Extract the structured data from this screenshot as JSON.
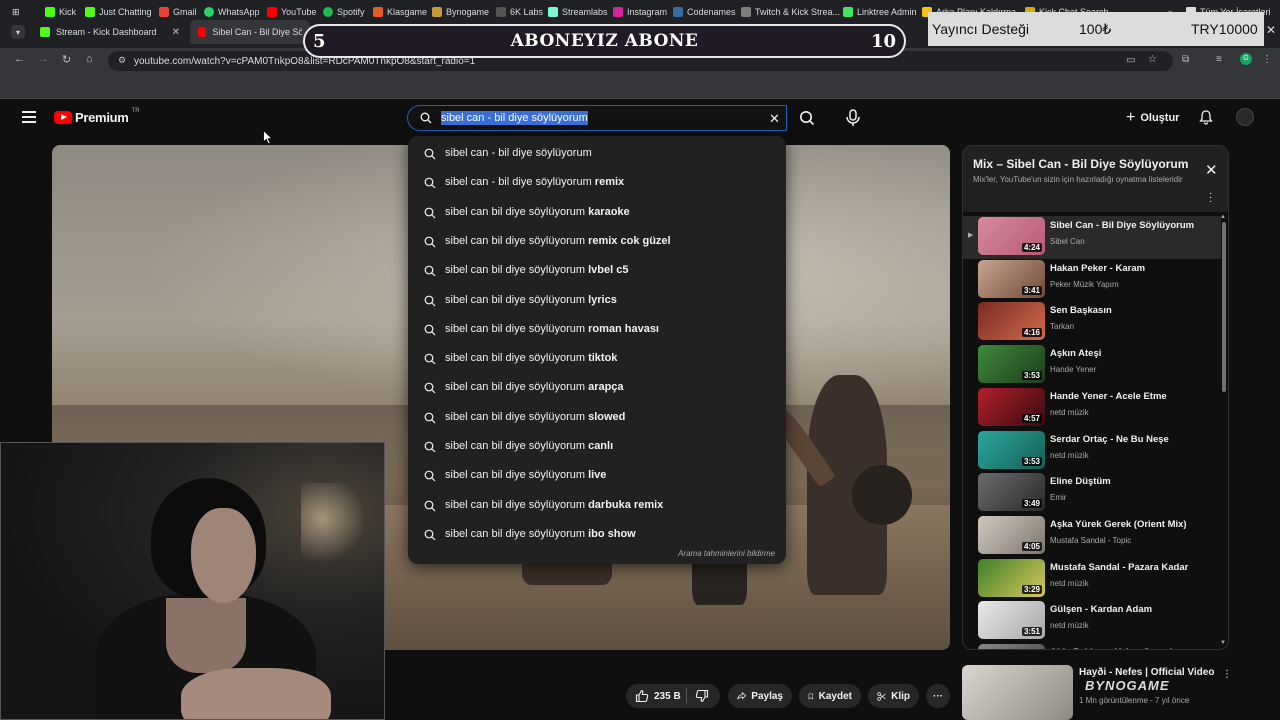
{
  "browser": {
    "tabs": [
      {
        "label": "Stream - Kick Dashboard",
        "fav_color": "#53fc18"
      },
      {
        "label": "Sibel Can - Bil Diye Söylüy",
        "fav_color": "#ff0000"
      }
    ],
    "url": "youtube.com/watch?v=cPAM0TnkpO8&list=RDcPAM0TnkpO8&start_radio=1",
    "bookmarks": [
      "Kick",
      "Just Chatting",
      "Gmail",
      "WhatsApp",
      "YouTube",
      "Spotify",
      "Klasgame",
      "Bynogame",
      "6K Labs",
      "Streamlabs",
      "Instagram",
      "Codenames",
      "Twitch & Kick Strea...",
      "Linktree Admin",
      "Arka Planı Kaldırma...",
      "Kick Chat Search"
    ],
    "all_bookmarks": "Tüm Yer İşaretleri"
  },
  "overlay": {
    "goal_left": "5",
    "goal_title": "ABONEYIZ ABONE",
    "goal_right": "10",
    "donate_label": "Yayıncı Desteği",
    "donate_amount": "100₺",
    "donate_goal": "TRY10000"
  },
  "youtube": {
    "logo": "Premium",
    "country": "TR",
    "search_value": "sibel can - bil diye söylüyorum",
    "create_label": "Oluştur",
    "suggestions": [
      {
        "prefix": "sibel can - bil diye söylüyorum",
        "suffix": ""
      },
      {
        "prefix": "sibel can - bil diye söylüyorum",
        "suffix": " remix"
      },
      {
        "prefix": "sibel can bil diye söylüyorum",
        "suffix": " karaoke"
      },
      {
        "prefix": "sibel can bil diye söylüyorum",
        "suffix": " remix cok güzel"
      },
      {
        "prefix": "sibel can bil diye söylüyorum",
        "suffix": " lvbel c5"
      },
      {
        "prefix": "sibel can bil diye söylüyorum",
        "suffix": " lyrics"
      },
      {
        "prefix": "sibel can bil diye söylüyorum",
        "suffix": " roman havası"
      },
      {
        "prefix": "sibel can bil diye söylüyorum",
        "suffix": " tiktok"
      },
      {
        "prefix": "sibel can bil diye söylüyorum",
        "suffix": " arapça"
      },
      {
        "prefix": "sibel can bil diye söylüyorum",
        "suffix": " slowed"
      },
      {
        "prefix": "sibel can bil diye söylüyorum",
        "suffix": " canlı"
      },
      {
        "prefix": "sibel can bil diye söylüyorum",
        "suffix": " live"
      },
      {
        "prefix": "sibel can bil diye söylüyorum",
        "suffix": " darbuka remix"
      },
      {
        "prefix": "sibel can bil diye söylüyorum",
        "suffix": " ibo show"
      }
    ],
    "suggest_footer": "Arama tahminlerini bildirme",
    "mix": {
      "title": "Mix – Sibel Can - Bil Diye Söylüyorum",
      "subtitle": "Mix'ler, YouTube'un sizin için hazırladığı oynatma listeleridir",
      "items": [
        {
          "title": "Sibel Can - Bil Diye Söylüyorum",
          "channel": "Sibel Can",
          "duration": "4:24",
          "c1": "#d78aa0",
          "c2": "#b85a72"
        },
        {
          "title": "Hakan Peker - Karam",
          "channel": "Peker Müzik Yapım",
          "duration": "3:41",
          "c1": "#c9a48d",
          "c2": "#6e4b3a"
        },
        {
          "title": "Sen Başkasın",
          "channel": "Tarkan",
          "duration": "4:16",
          "c1": "#7a2b22",
          "c2": "#d06b4c"
        },
        {
          "title": "Aşkın Ateşi",
          "channel": "Hande Yener",
          "duration": "3:53",
          "c1": "#3d8a3a",
          "c2": "#1e3d1e"
        },
        {
          "title": "Hande Yener - Acele Etme",
          "channel": "netd müzik",
          "duration": "4:57",
          "c1": "#b0202a",
          "c2": "#3a0a10"
        },
        {
          "title": "Serdar Ortaç - Ne Bu Neşe",
          "channel": "netd müzik",
          "duration": "3:53",
          "c1": "#2aa79b",
          "c2": "#155f58"
        },
        {
          "title": "Eline Düştüm",
          "channel": "Emir",
          "duration": "3:49",
          "c1": "#6b6b6b",
          "c2": "#2a2a2a"
        },
        {
          "title": "Aşka Yürek Gerek (Orient Mix)",
          "channel": "Mustafa Sandal - Topic",
          "duration": "4:05",
          "c1": "#cfc9c0",
          "c2": "#7d7670"
        },
        {
          "title": "Mustafa Sandal - Pazara Kadar",
          "channel": "netd müzik",
          "duration": "3:29",
          "c1": "#3f7f2a",
          "c2": "#d8c85a"
        },
        {
          "title": "Gülşen - Kardan Adam",
          "channel": "netd müzik",
          "duration": "3:51",
          "c1": "#e8e8e8",
          "c2": "#a8a8a8"
        },
        {
          "title": "Aida Pekkan - Yakar Geçerim",
          "channel": "",
          "duration": "",
          "c1": "#888",
          "c2": "#444"
        }
      ]
    },
    "recommended": {
      "title": "Hayði - Nefes | Official Video",
      "meta": "1 Mn görüntülenme - 7 yıl önce"
    },
    "watermark": "BYNOGAME",
    "actions": {
      "likes": "235 B",
      "share": "Paylaş",
      "save": "Kaydet",
      "clip": "Klip"
    }
  }
}
